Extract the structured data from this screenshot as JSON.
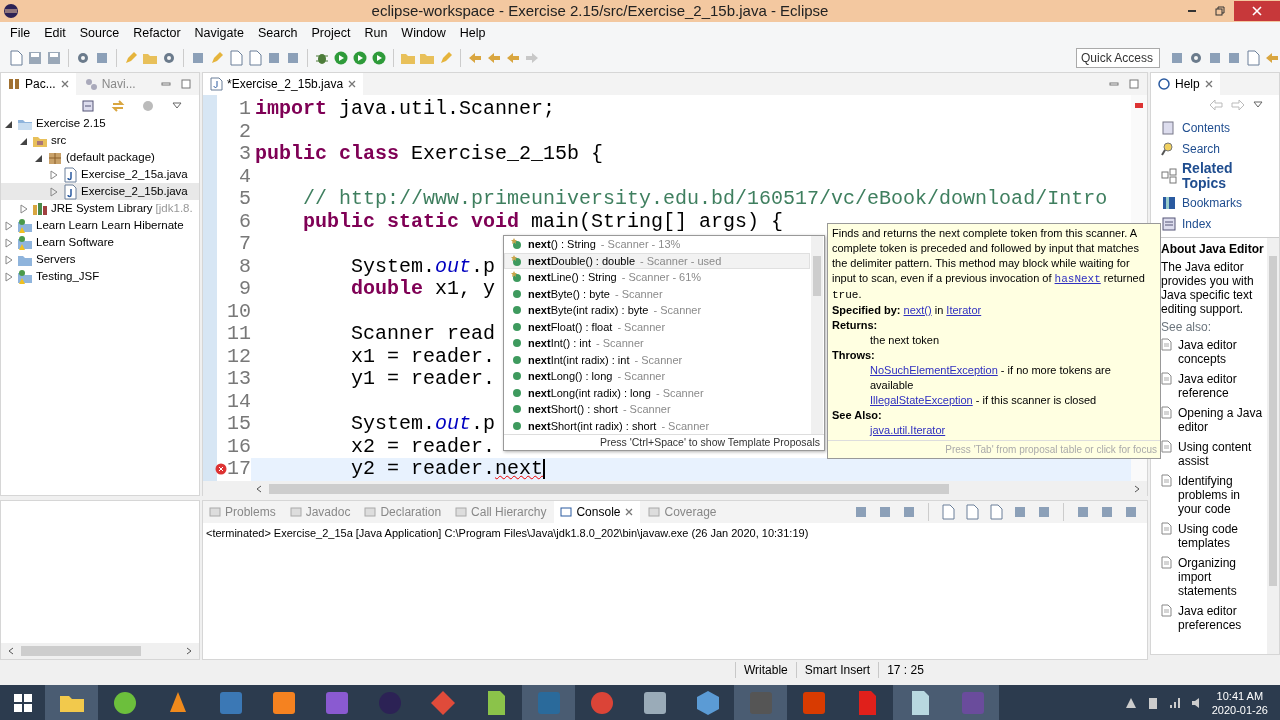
{
  "window": {
    "title": "eclipse-workspace - Exercise 2.15/src/Exercise_2_15b.java - Eclipse"
  },
  "menu": [
    "File",
    "Edit",
    "Source",
    "Refactor",
    "Navigate",
    "Search",
    "Project",
    "Run",
    "Window",
    "Help"
  ],
  "quick_access": {
    "placeholder": "Quick Access"
  },
  "explorer": {
    "tabs": [
      {
        "label": "Pac...",
        "selected": true
      },
      {
        "label": "Navi...",
        "selected": false
      }
    ],
    "tree": [
      {
        "label": "Exercise 2.15",
        "kind": "project",
        "expanded": true,
        "selected": false,
        "children": [
          {
            "label": "src",
            "kind": "folder",
            "expanded": true,
            "selected": false,
            "children": [
              {
                "label": "(default package)",
                "kind": "package",
                "expanded": true,
                "selected": false,
                "children": [
                  {
                    "label": "Exercise_2_15a.java",
                    "kind": "java",
                    "expanded": false,
                    "selected": false
                  },
                  {
                    "label": "Exercise_2_15b.java",
                    "kind": "java",
                    "expanded": false,
                    "selected": true
                  }
                ]
              }
            ]
          },
          {
            "label": "JRE System Library",
            "suffix": "[jdk1.8.",
            "kind": "library",
            "expanded": false,
            "selected": false
          }
        ]
      },
      {
        "label": "Learn Learn Learn Hibernate",
        "kind": "project_warn",
        "expanded": false,
        "selected": false
      },
      {
        "label": "Learn Software",
        "kind": "project_warn",
        "expanded": false,
        "selected": false
      },
      {
        "label": "Servers",
        "kind": "servers",
        "expanded": false,
        "selected": false
      },
      {
        "label": "Testing_JSF",
        "kind": "project_warn",
        "expanded": false,
        "selected": false
      }
    ]
  },
  "editor": {
    "tab": {
      "label": "*Exercise_2_15b.java",
      "selected": true
    },
    "lines": [
      {
        "number": "1",
        "tokens": [
          {
            "kind": "kw",
            "text": "import"
          },
          {
            "kind": "plain",
            "text": " java.util.Scanner;"
          }
        ]
      },
      {
        "number": "2"
      },
      {
        "number": "3",
        "tokens": [
          {
            "kind": "kw",
            "text": "public class"
          },
          {
            "kind": "plain",
            "text": " Exercise_2_15b {"
          }
        ]
      },
      {
        "number": "4"
      },
      {
        "number": "5",
        "tokens": [
          {
            "kind": "comment",
            "text": "    // http://www.primeuniversity.edu.bd/160517/vc/eBook/download/Intro"
          }
        ]
      },
      {
        "number": "6",
        "tokens": [
          {
            "kind": "kw",
            "text": "    public static void"
          },
          {
            "kind": "plain",
            "text": " main(String[] args) {"
          }
        ]
      },
      {
        "number": "7"
      },
      {
        "number": "8",
        "tokens": [
          {
            "kind": "plain",
            "text": "        System."
          },
          {
            "kind": "field",
            "text": "out"
          },
          {
            "kind": "plain",
            "text": ".p"
          }
        ]
      },
      {
        "number": "9",
        "tokens": [
          {
            "kind": "kw",
            "text": "        double"
          },
          {
            "kind": "plain",
            "text": " x1, y"
          }
        ]
      },
      {
        "number": "10"
      },
      {
        "number": "11",
        "tokens": [
          {
            "kind": "plain",
            "text": "        Scanner read"
          }
        ]
      },
      {
        "number": "12",
        "tokens": [
          {
            "kind": "plain",
            "text": "        x1 = reader."
          }
        ]
      },
      {
        "number": "13",
        "tokens": [
          {
            "kind": "plain",
            "text": "        y1 = reader."
          }
        ]
      },
      {
        "number": "14"
      },
      {
        "number": "15",
        "tokens": [
          {
            "kind": "plain",
            "text": "        System."
          },
          {
            "kind": "field",
            "text": "out"
          },
          {
            "kind": "plain",
            "text": ".p"
          }
        ]
      },
      {
        "number": "16",
        "tokens": [
          {
            "kind": "plain",
            "text": "        x2 = reader."
          }
        ]
      },
      {
        "number": "17",
        "current": true,
        "error": true,
        "tokens": [
          {
            "kind": "plain",
            "text": "        y2 = reader."
          },
          {
            "kind": "error",
            "text": "next"
          }
        ]
      }
    ]
  },
  "completion": {
    "items": [
      {
        "label": "**next**() : String",
        "detail": " - Scanner - 13%",
        "kind": "recommended",
        "selected": false
      },
      {
        "label": "**next**Double() : double",
        "detail": " - Scanner - used",
        "kind": "recommended",
        "selected": true
      },
      {
        "label": "**next**Line() : String",
        "detail": " - Scanner - 61%",
        "kind": "recommended",
        "selected": false
      },
      {
        "label": "**next**Byte() : byte",
        "detail": " - Scanner",
        "kind": "method",
        "selected": false
      },
      {
        "label": "**next**Byte(int radix) : byte",
        "detail": " - Scanner",
        "kind": "method",
        "selected": false
      },
      {
        "label": "**next**Float() : float",
        "detail": " - Scanner",
        "kind": "method",
        "selected": false
      },
      {
        "label": "**next**Int() : int",
        "detail": " - Scanner",
        "kind": "method",
        "selected": false
      },
      {
        "label": "**next**Int(int radix) : int",
        "detail": " - Scanner",
        "kind": "method",
        "selected": false
      },
      {
        "label": "**next**Long() : long",
        "detail": " - Scanner",
        "kind": "method",
        "selected": false
      },
      {
        "label": "**next**Long(int radix) : long",
        "detail": " - Scanner",
        "kind": "method",
        "selected": false
      },
      {
        "label": "**next**Short() : short",
        "detail": " - Scanner",
        "kind": "method",
        "selected": false
      },
      {
        "label": "**next**Short(int radix) : short",
        "detail": " - Scanner",
        "kind": "method",
        "selected": false
      }
    ],
    "footer": "Press 'Ctrl+Space' to show Template Proposals"
  },
  "javadoc": {
    "description": [
      {
        "kind": "text",
        "text": "Finds and returns the next complete token from this scanner. A complete token is preceded and followed by input that matches the delimiter pattern. This method may block while waiting for input to scan, even if a previous invocation of "
      },
      {
        "kind": "code_link",
        "text": "hasNext"
      },
      {
        "kind": "text",
        "text": " returned "
      },
      {
        "kind": "code",
        "text": "true"
      },
      {
        "kind": "text",
        "text": "."
      }
    ],
    "sections": [
      {
        "heading": "Specified by:",
        "kind": "inline",
        "entries": [
          [
            {
              "kind": "link",
              "text": "next()"
            },
            {
              "kind": "text",
              "text": " in "
            },
            {
              "kind": "link",
              "text": "Iterator"
            }
          ]
        ]
      },
      {
        "heading": "Returns:",
        "kind": "block",
        "entries": [
          [
            {
              "kind": "text",
              "text": "the next token"
            }
          ]
        ]
      },
      {
        "heading": "Throws:",
        "kind": "block",
        "entries": [
          [
            {
              "kind": "link",
              "text": "NoSuchElementException"
            },
            {
              "kind": "text",
              "text": " - if no more tokens are available"
            }
          ],
          [
            {
              "kind": "link",
              "text": "IllegalStateException"
            },
            {
              "kind": "text",
              "text": " - if this scanner is closed"
            }
          ]
        ]
      },
      {
        "heading": "See Also:",
        "kind": "block",
        "entries": [
          [
            {
              "kind": "link",
              "text": "java.util.Iterator"
            }
          ]
        ]
      }
    ],
    "footer": "Press 'Tab' from proposal table or click for focus"
  },
  "help": {
    "tab": "Help",
    "nav": [
      {
        "label": "Contents",
        "kind": "contents",
        "selected": false
      },
      {
        "label": "Search",
        "kind": "search",
        "selected": false
      },
      {
        "label": "Related Topics",
        "kind": "related",
        "selected": true
      },
      {
        "label": "Bookmarks",
        "kind": "bookmarks",
        "selected": false
      },
      {
        "label": "Index",
        "kind": "index",
        "selected": false
      }
    ],
    "title": "About Java Editor",
    "text": "The Java editor provides you with Java specific text editing support.",
    "see_also": "See also:",
    "links": [
      "Java editor concepts",
      "Java editor reference",
      "Opening a Java editor",
      "Using content assist",
      "Identifying problems in your code",
      "Using code templates",
      "Organizing import statements",
      "Java editor preferences"
    ]
  },
  "console": {
    "tabs": [
      {
        "label": "Problems",
        "selected": false
      },
      {
        "label": "Javadoc",
        "selected": false
      },
      {
        "label": "Declaration",
        "selected": false
      },
      {
        "label": "Call Hierarchy",
        "selected": false
      },
      {
        "label": "Console",
        "selected": true
      },
      {
        "label": "Coverage",
        "selected": false
      }
    ],
    "line": "<terminated> Exercise_2_15a [Java Application] C:\\Program Files\\Java\\jdk1.8.0_202\\bin\\javaw.exe (26 Jan 2020, 10:31:19)"
  },
  "status_bar": [
    "Writable",
    "Smart Insert",
    "17 : 25"
  ],
  "taskbar": {
    "apps": [
      {
        "kind": "folder",
        "color": "#f2c94c",
        "running": true
      },
      {
        "kind": "circle",
        "color": "#6cbf3c",
        "running": false
      },
      {
        "kind": "cone",
        "color": "#f08a1c",
        "running": false
      },
      {
        "kind": "square",
        "color": "#3b78b5",
        "running": false
      },
      {
        "kind": "square",
        "color": "#f58220",
        "running": false
      },
      {
        "kind": "square",
        "color": "#8a5ad1",
        "running": false
      },
      {
        "kind": "circle",
        "color": "#2c2255",
        "running": false
      },
      {
        "kind": "diamond",
        "color": "#e04b3a",
        "running": false
      },
      {
        "kind": "page",
        "color": "#8bc34a",
        "running": false
      },
      {
        "kind": "square",
        "color": "#2a6a9b",
        "running": true
      },
      {
        "kind": "circle",
        "color": "#db4437",
        "running": false
      },
      {
        "kind": "square",
        "color": "#9aabb8",
        "running": false
      },
      {
        "kind": "cube",
        "color": "#5b9bd5",
        "running": false
      },
      {
        "kind": "square",
        "color": "#555555",
        "running": true
      },
      {
        "kind": "square",
        "color": "#d83b01",
        "running": false
      },
      {
        "kind": "page",
        "color": "#e0201b",
        "running": false
      },
      {
        "kind": "page",
        "color": "#b8d8e0",
        "running": true
      },
      {
        "kind": "square",
        "color": "#6a4c9c",
        "running": true
      }
    ],
    "time": "10:41 AM",
    "date": "2020-01-26"
  }
}
